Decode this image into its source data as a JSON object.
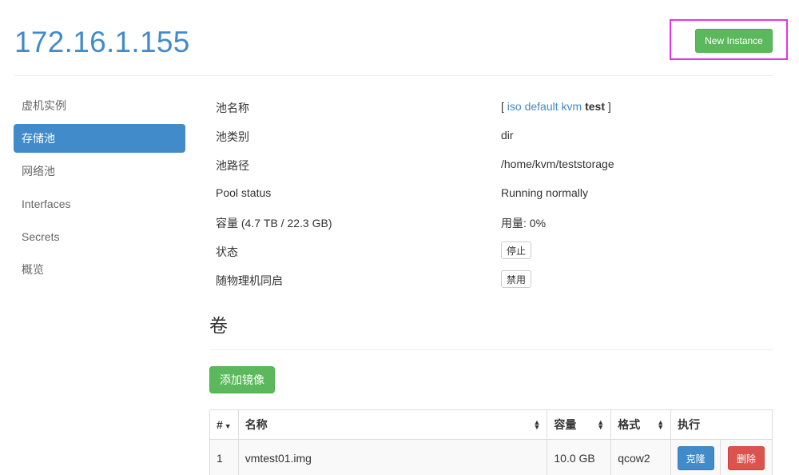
{
  "header": {
    "host_title": "172.16.1.155",
    "new_instance_label": "New Instance"
  },
  "sidebar": {
    "items": [
      {
        "label": "虚机实例",
        "active": false
      },
      {
        "label": "存储池",
        "active": true
      },
      {
        "label": "网络池",
        "active": false
      },
      {
        "label": "Interfaces",
        "active": false
      },
      {
        "label": "Secrets",
        "active": false
      },
      {
        "label": "概览",
        "active": false
      }
    ]
  },
  "pool": {
    "name_label": "池名称",
    "pools_open": "[",
    "pool_links": [
      "iso",
      "default",
      "kvm"
    ],
    "current_pool": "test",
    "pools_close": "]",
    "type_label": "池类别",
    "type_value": "dir",
    "path_label": "池路径",
    "path_value": "/home/kvm/teststorage",
    "status_label": "Pool status",
    "status_value": "Running normally",
    "capacity_label": "容量",
    "capacity_detail": "(4.7 TB / 22.3 GB)",
    "usage_value": "用量: 0%",
    "state_label": "状态",
    "state_button": "停止",
    "autostart_label": "随物理机同启",
    "autostart_button": "禁用"
  },
  "volumes": {
    "title": "卷",
    "add_button": "添加镜像",
    "columns": [
      "#",
      "名称",
      "容量",
      "格式",
      "执行"
    ],
    "rows": [
      {
        "index": "1",
        "name": "vmtest01.img",
        "size": "10.0 GB",
        "format": "qcow2",
        "clone_label": "克隆",
        "delete_label": "删除"
      }
    ]
  },
  "colors": {
    "primary": "#428bca",
    "success": "#5cb85c",
    "danger": "#d9534f",
    "highlight_box": "#e633e6"
  }
}
